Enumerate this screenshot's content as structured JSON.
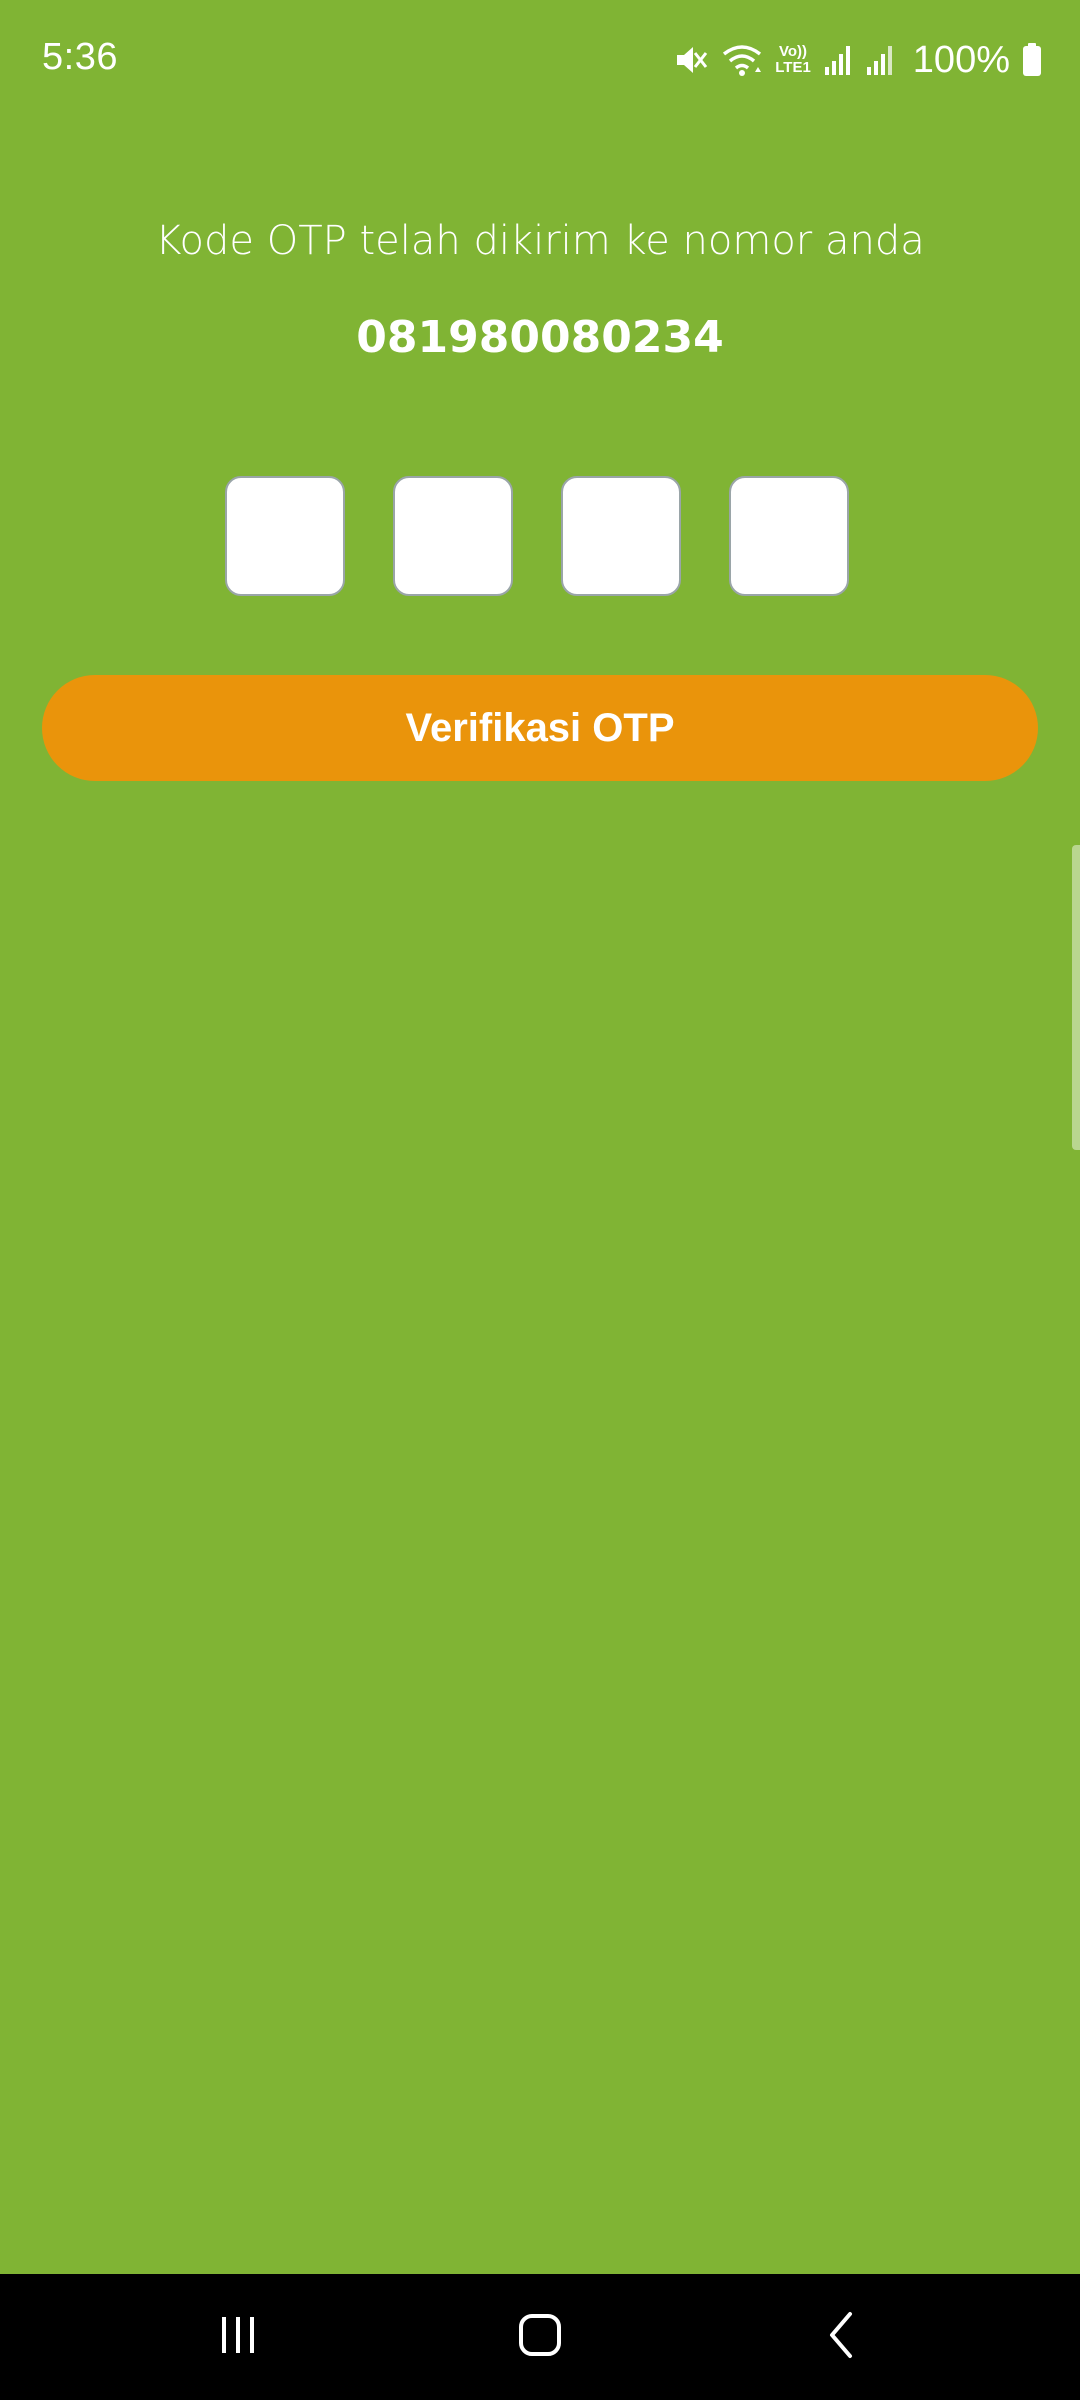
{
  "status_bar": {
    "time": "5:36",
    "battery": "100%",
    "icons": [
      "mute-icon",
      "wifi-icon",
      "volte-icon",
      "signal-icon",
      "signal-icon",
      "battery-icon"
    ],
    "volte_label_top": "Vo))",
    "volte_label_bottom": "LTE1"
  },
  "otp": {
    "message": "Kode OTP telah dikirim ke nomor anda",
    "phone_number": "081980080234",
    "digits": [
      "",
      "",
      "",
      ""
    ]
  },
  "actions": {
    "verify_label": "Verifikasi OTP"
  },
  "navigation": {
    "icons": [
      "recents-icon",
      "home-icon",
      "back-icon"
    ]
  },
  "colors": {
    "background": "#80b434",
    "button": "#ea940b",
    "text": "#ffffff",
    "nav_bar": "#000000"
  }
}
